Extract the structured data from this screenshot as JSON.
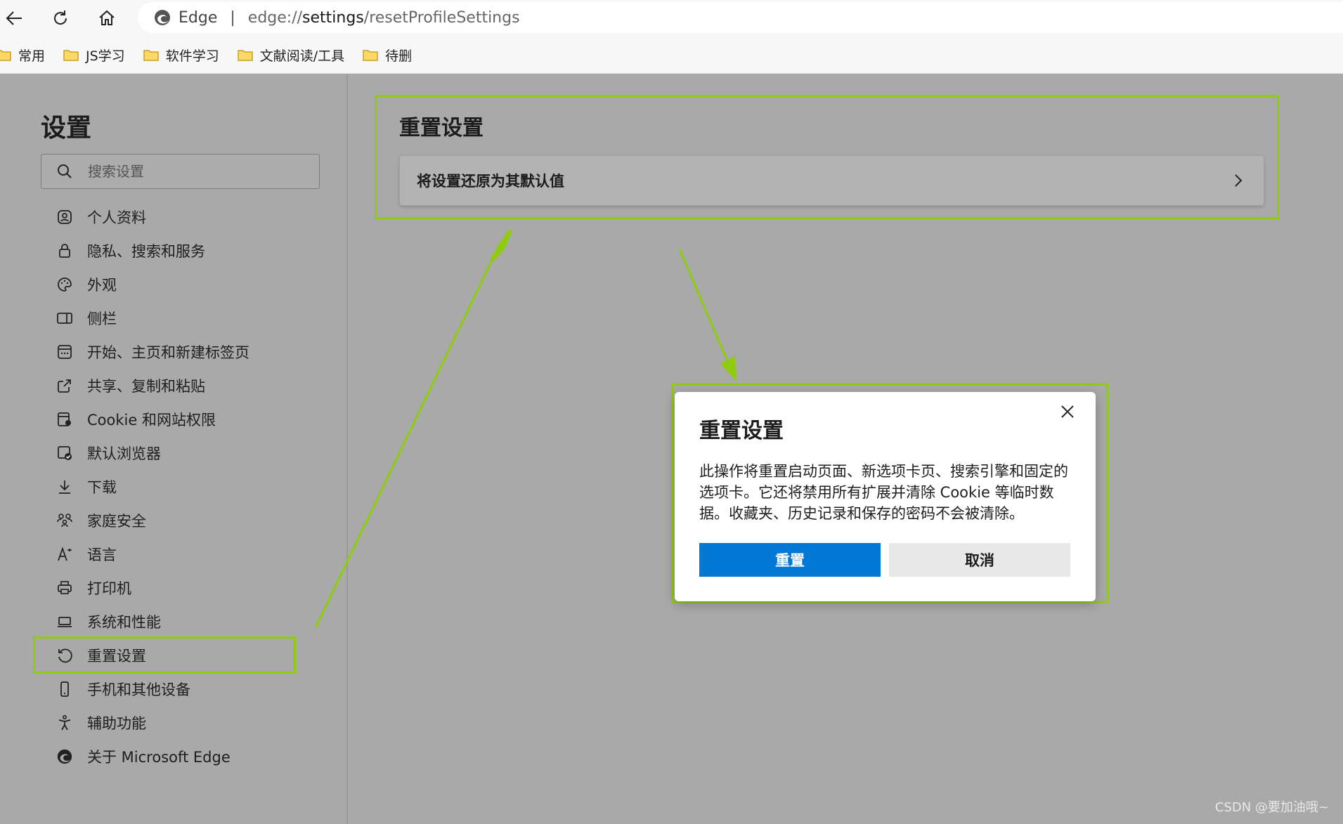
{
  "browser": {
    "brand": "Edge",
    "url_prefix": "edge://",
    "url_host": "settings",
    "url_path": "/resetProfileSettings"
  },
  "favorites": [
    {
      "label": "常用"
    },
    {
      "label": "JS学习"
    },
    {
      "label": "软件学习"
    },
    {
      "label": "文献阅读/工具"
    },
    {
      "label": "待删"
    }
  ],
  "sidebar": {
    "title": "设置",
    "search_placeholder": "搜索设置",
    "items": [
      {
        "label": "个人资料",
        "icon": "profile-icon"
      },
      {
        "label": "隐私、搜索和服务",
        "icon": "lock-icon"
      },
      {
        "label": "外观",
        "icon": "palette-icon"
      },
      {
        "label": "侧栏",
        "icon": "sidebar-icon"
      },
      {
        "label": "开始、主页和新建标签页",
        "icon": "newtab-icon"
      },
      {
        "label": "共享、复制和粘贴",
        "icon": "share-icon"
      },
      {
        "label": "Cookie 和网站权限",
        "icon": "cookie-permissions-icon"
      },
      {
        "label": "默认浏览器",
        "icon": "default-browser-icon"
      },
      {
        "label": "下载",
        "icon": "download-icon"
      },
      {
        "label": "家庭安全",
        "icon": "family-icon"
      },
      {
        "label": "语言",
        "icon": "language-icon"
      },
      {
        "label": "打印机",
        "icon": "printer-icon"
      },
      {
        "label": "系统和性能",
        "icon": "laptop-icon"
      },
      {
        "label": "重置设置",
        "icon": "reset-icon"
      },
      {
        "label": "手机和其他设备",
        "icon": "phone-icon"
      },
      {
        "label": "辅助功能",
        "icon": "accessibility-icon"
      },
      {
        "label": "关于 Microsoft Edge",
        "icon": "edge-logo-icon"
      }
    ]
  },
  "main": {
    "title": "重置设置",
    "card_label": "将设置还原为其默认值"
  },
  "dialog": {
    "title": "重置设置",
    "body": "此操作将重置启动页面、新选项卡页、搜索引擎和固定的选项卡。它还将禁用所有扩展并清除 Cookie 等临时数据。收藏夹、历史记录和保存的密码不会被清除。",
    "confirm_label": "重置",
    "cancel_label": "取消"
  },
  "watermark": "CSDN @要加油哦~",
  "colors": {
    "highlight": "#8fcc10",
    "primary_button": "#0078d4"
  }
}
